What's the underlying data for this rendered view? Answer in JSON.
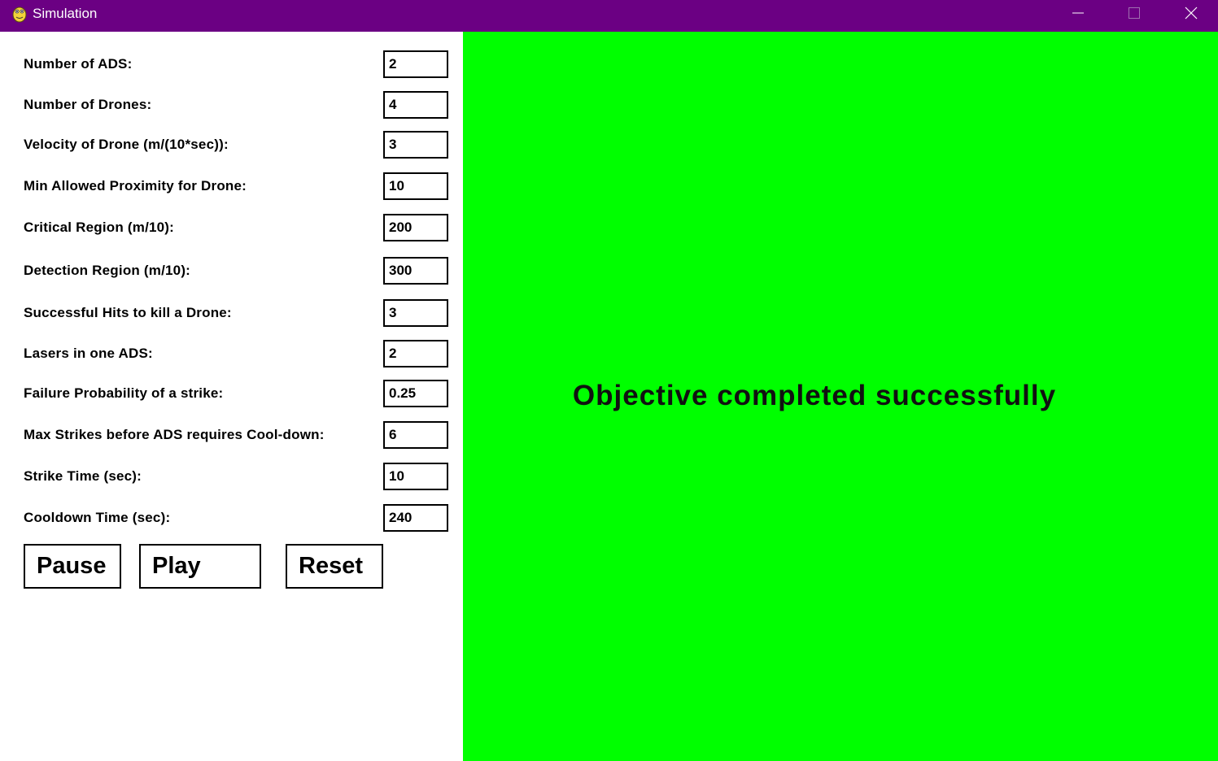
{
  "window": {
    "title": "Simulation",
    "icon": "pygame-snake-icon",
    "controls": [
      "minimize-icon",
      "maximize-icon",
      "close-icon"
    ],
    "titlebar_color": "#6b0083"
  },
  "params": [
    {
      "label": "Number of ADS:",
      "value": "2"
    },
    {
      "label": "Number of Drones:",
      "value": "4"
    },
    {
      "label": "Velocity of Drone (m/(10*sec)):",
      "value": "3"
    },
    {
      "label": "Min Allowed Proximity for Drone:",
      "value": "10"
    },
    {
      "label": "Critical Region (m/10):",
      "value": "200"
    },
    {
      "label": "Detection Region (m/10):",
      "value": "300"
    },
    {
      "label": "Successful Hits to kill a Drone:",
      "value": "3"
    },
    {
      "label": "Lasers in one ADS:",
      "value": "2"
    },
    {
      "label": "Failure Probability of a strike:",
      "value": "0.25"
    },
    {
      "label": "Max Strikes before ADS requires Cool-down:",
      "value": "6"
    },
    {
      "label": "Strike Time (sec):",
      "value": "10"
    },
    {
      "label": "Cooldown Time (sec):",
      "value": "240"
    }
  ],
  "controls": {
    "pause_label": "Pause",
    "play_label": "Play",
    "reset_label": "Reset"
  },
  "canvas": {
    "background": "#00ff00",
    "message": "Objective completed successfully"
  }
}
